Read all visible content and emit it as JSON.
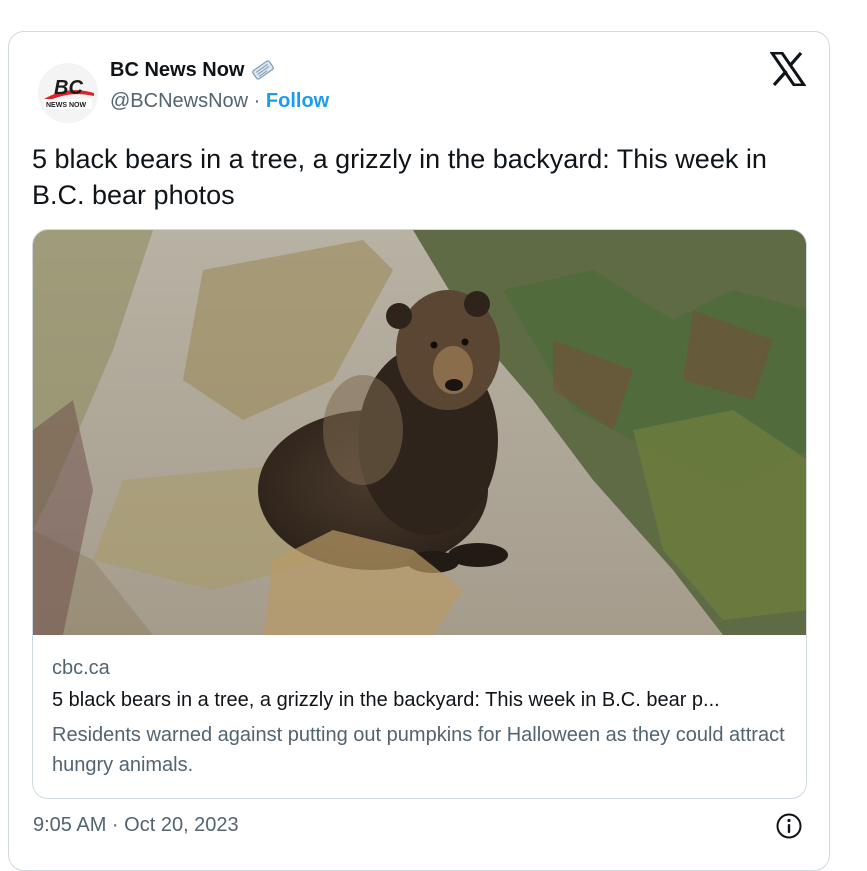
{
  "author": {
    "name": "BC News Now",
    "handle": "@BCNewsNow",
    "separator": "·",
    "follow_label": "Follow",
    "avatar_text_top": "BC",
    "avatar_text_bottom": "NEWS NOW",
    "badge_icon": "newspaper-icon"
  },
  "tweet": {
    "text": "5 black bears in a tree, a grizzly in the backyard: This week in B.C. bear photos"
  },
  "link_card": {
    "image_icon": "grizzly-bear-photo",
    "domain": "cbc.ca",
    "title": "5 black bears in a tree, a grizzly in the backyard: This week in B.C. bear p...",
    "description": "Residents warned against putting out pumpkins for Halloween as they could attract hungry animals."
  },
  "footer": {
    "timestamp": "9:05 AM · Oct 20, 2023",
    "info_icon": "info-icon"
  },
  "colors": {
    "accent": "#1d9bf0",
    "secondary_text": "#536471",
    "border": "#cfd9de",
    "brand_red": "#d7262b"
  }
}
